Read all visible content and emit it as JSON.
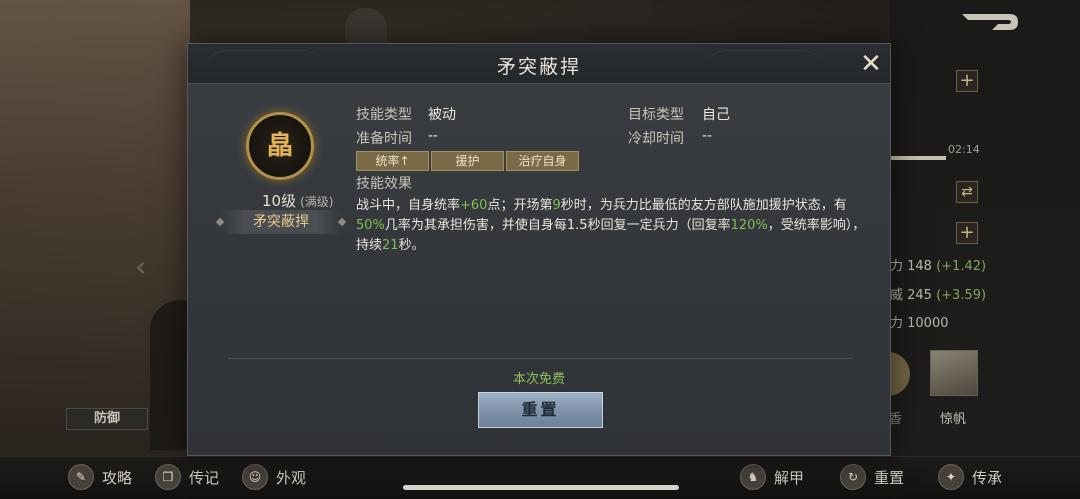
{
  "dialog": {
    "title": "矛突蔽捍",
    "skill": {
      "icon_glyph": "皛",
      "level": "10级",
      "level_note": "(满级)",
      "name": "矛突蔽捍"
    },
    "info": {
      "skill_type_label": "技能类型",
      "skill_type_value": "被动",
      "target_type_label": "目标类型",
      "target_type_value": "自己",
      "prep_time_label": "准备时间",
      "prep_time_value": "--",
      "cooldown_label": "冷却时间",
      "cooldown_value": "--"
    },
    "tags": [
      "统率↑",
      "援护",
      "治疗自身"
    ],
    "effect_label": "技能效果",
    "effect": {
      "p1": "战斗中，自身统率",
      "v1": "+60",
      "p2": "点；开场第",
      "v2": "9",
      "p3": "秒时，为兵力比最低的友方部队施加援护状态，有",
      "v3": "50%",
      "p4": "几率为其承担伤害，并使自身每1.5秒回复一定兵力（回复率",
      "v4": "120%",
      "p5": "，受统率影响），持续",
      "v5": "21",
      "p6": "秒。"
    },
    "free_text": "本次免费",
    "reset_label": "重置",
    "close_icon": "close-icon"
  },
  "background": {
    "defense_tag": "防御",
    "progress_time": "02:14",
    "stats": [
      {
        "label": "力 148",
        "delta": "(+1.42)"
      },
      {
        "label": "威 245",
        "delta": "(+3.59)"
      },
      {
        "label": "力 10000",
        "delta": ""
      }
    ],
    "mount_name": "惊帆",
    "partial_char": "香"
  },
  "bottom_bar": {
    "left": [
      {
        "icon": "strategy-icon",
        "label": "攻略"
      },
      {
        "icon": "biography-icon",
        "label": "传记"
      },
      {
        "icon": "appearance-icon",
        "label": "外观"
      }
    ],
    "right": [
      {
        "icon": "unequip-icon",
        "label": "解甲"
      },
      {
        "icon": "reset-icon",
        "label": "重置"
      },
      {
        "icon": "inherit-icon",
        "label": "传承"
      }
    ]
  },
  "colors": {
    "highlight_green": "#7fbf4f",
    "skill_name_gold": "#e8c98a",
    "reset_button": "#8fa2b8"
  }
}
